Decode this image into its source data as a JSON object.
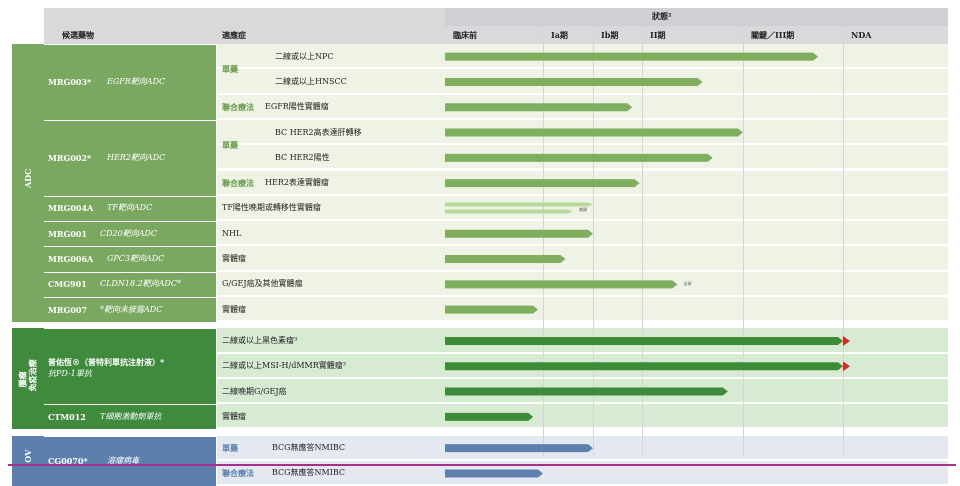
{
  "header": {
    "candidate": "候選藥物",
    "indication": "適應症",
    "status": "狀態²",
    "phases": [
      "臨床前",
      "Ia期",
      "Ib期",
      "II期",
      "關鍵／III期",
      "NDA"
    ]
  },
  "categories": [
    {
      "label": "ADC",
      "color": "#7aa860"
    },
    {
      "label": "腫瘤\n免疫治療",
      "color": "#3f8a3c"
    },
    {
      "label": "OV",
      "color": "#5d7fae"
    }
  ],
  "groups": [
    {
      "cat": 0,
      "name": "MRG003*",
      "target": "EGFR靶向ADC",
      "rows": [
        0,
        1,
        2
      ]
    },
    {
      "cat": 0,
      "name": "MRG002*",
      "target": "HER2靶向ADC",
      "rows": [
        3,
        4,
        5
      ]
    },
    {
      "cat": 0,
      "name": "MRG004A",
      "target": "TF靶向ADC",
      "rows": [
        6
      ]
    },
    {
      "cat": 0,
      "name": "MRG001",
      "target": "CD20靶向ADC",
      "rows": [
        7
      ]
    },
    {
      "cat": 0,
      "name": "MRG006A",
      "target": "GPC3靶向ADC",
      "rows": [
        8
      ]
    },
    {
      "cat": 0,
      "name": "CMG901",
      "target": "CLDN18.2靶向ADC*",
      "rows": [
        9
      ]
    },
    {
      "cat": 0,
      "name": "MRG007",
      "target": "*靶向未披露ADC",
      "rows": [
        10
      ]
    },
    {
      "cat": 1,
      "name": "普佑恆®（普特利單抗注射液）*",
      "target": "抗PD-1單抗",
      "rows": [
        11,
        12,
        13
      ]
    },
    {
      "cat": 1,
      "name": "CTM012",
      "target": "T細胞激動劑單抗",
      "rows": [
        14
      ]
    },
    {
      "cat": 2,
      "name": "CG0070*",
      "target": "溶瘤病毒",
      "rows": [
        15,
        16
      ]
    }
  ],
  "rows": [
    {
      "sub": "單藥",
      "indication": "二線或以上NPC",
      "progress": 4.75,
      "arrow": false,
      "note": ""
    },
    {
      "sub": "",
      "indication": "二線或以上HNSCC",
      "progress": 3.6,
      "arrow": false,
      "note": ""
    },
    {
      "sub": "聯合療法",
      "indication": "EGFR陽性實體瘤",
      "progress": 2.8,
      "arrow": false,
      "note": ""
    },
    {
      "sub": "單藥",
      "indication": "BC HER2高表達肝轉移",
      "progress": 4.0,
      "arrow": false,
      "note": ""
    },
    {
      "sub": "",
      "indication": "BC HER2陽性",
      "progress": 3.7,
      "arrow": false,
      "note": ""
    },
    {
      "sub": "聯合療法",
      "indication": "HER2表達實體瘤",
      "progress": 2.95,
      "arrow": false,
      "note": ""
    },
    {
      "sub": "",
      "indication": "TF陽性晚期或轉移性實體瘤",
      "progress": 2.0,
      "progress2": 1.6,
      "arrow": false,
      "note": "美國"
    },
    {
      "sub": "",
      "indication": "NHL",
      "progress": 2.0,
      "arrow": false,
      "note": ""
    },
    {
      "sub": "",
      "indication": "實體瘤",
      "progress": 1.45,
      "arrow": false,
      "note": ""
    },
    {
      "sub": "",
      "indication": "G/GEJ癌及其他實體瘤",
      "progress": 3.35,
      "arrow": false,
      "note": "全球"
    },
    {
      "sub": "",
      "indication": "實體瘤",
      "progress": 0.95,
      "arrow": false,
      "note": ""
    },
    {
      "sub": "",
      "indication": "二線或以上黑色素瘤³",
      "progress": 5.0,
      "arrow": true,
      "note": ""
    },
    {
      "sub": "",
      "indication": "二線或以上MSI-H/dMMR實體瘤³",
      "progress": 5.0,
      "arrow": true,
      "note": ""
    },
    {
      "sub": "",
      "indication": "二線晚期G/GEJ癌",
      "progress": 3.85,
      "arrow": false,
      "note": ""
    },
    {
      "sub": "",
      "indication": "實體瘤",
      "progress": 0.9,
      "arrow": false,
      "note": ""
    },
    {
      "sub": "單藥",
      "indication": "BCG無應答NMIBC",
      "progress": 2.0,
      "arrow": false,
      "note": ""
    },
    {
      "sub": "聯合療法",
      "indication": "BCG無應答NMIBC",
      "progress": 1.0,
      "arrow": false,
      "note": ""
    }
  ],
  "chart_data": {
    "type": "bar",
    "title": "狀態²",
    "categories": [
      "臨床前",
      "Ia期",
      "Ib期",
      "II期",
      "關鍵／III期",
      "NDA"
    ],
    "series": [
      {
        "values": [
          4.75,
          3.6,
          2.8,
          4.0,
          3.7,
          2.95,
          2.0,
          2.0,
          1.45,
          3.35,
          0.95,
          5.0,
          5.0,
          3.85,
          0.9,
          2.0,
          1.0
        ]
      }
    ],
    "value_axis": "phase index (0 = start of 臨床前, 6 = end of NDA)",
    "xlim": [
      0,
      6
    ]
  },
  "colors": {
    "adc_bar": "#7fae5e",
    "adc_bar_light": "#b9d89c",
    "io_bar": "#3e8b3a",
    "ov_bar": "#5e80ad",
    "arrow_tip": "#d62a2a",
    "adc_row": "#eef3e5",
    "adc_row_alt": "#e5edd8",
    "io_row": "#d7ebd3",
    "ov_row": "#e4e9f1",
    "header": "#d9d9dc"
  }
}
